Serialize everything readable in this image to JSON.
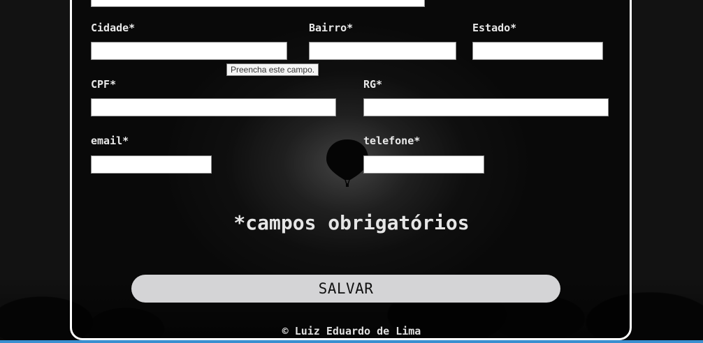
{
  "form": {
    "cidade": {
      "label": "Cidade*",
      "value": ""
    },
    "bairro": {
      "label": "Bairro*",
      "value": ""
    },
    "estado": {
      "label": "Estado*",
      "value": ""
    },
    "cpf": {
      "label": "CPF*",
      "value": ""
    },
    "rg": {
      "label": "RG*",
      "value": ""
    },
    "email": {
      "label": "email*",
      "value": ""
    },
    "telefone": {
      "label": "telefone*",
      "value": ""
    },
    "required_note": "*campos obrigatórios",
    "save_label": "SALVAR"
  },
  "tooltip": {
    "text": "Preencha este campo."
  },
  "footer": {
    "text": "© Luiz Eduardo de Lima"
  },
  "colors": {
    "accent_taskbar": "#3a8fd0",
    "button_bg": "#d4d4d6",
    "panel_border": "#ffffff"
  }
}
